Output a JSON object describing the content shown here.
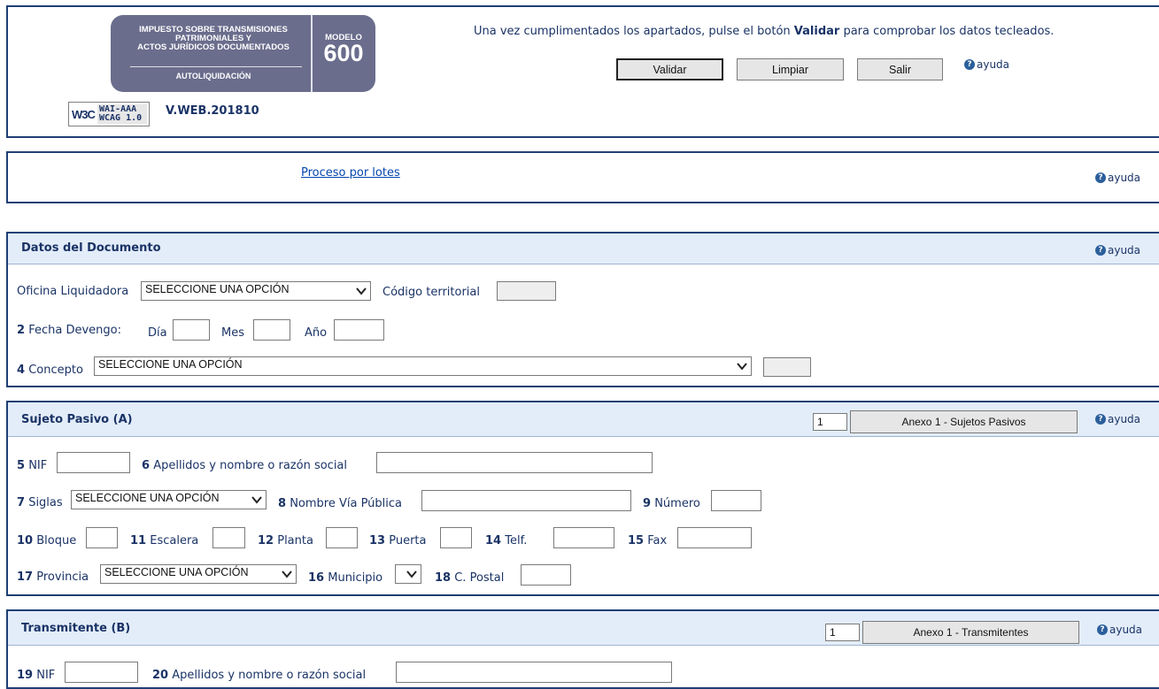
{
  "header": {
    "logo": {
      "line1": "IMPUESTO SOBRE TRANSMISIONES",
      "line2": "PATRIMONIALES Y",
      "line3": "ACTOS JURÍDICOS DOCUMENTADOS",
      "line4": "AUTOLIQUIDACIÓN",
      "modelo_label": "MODELO",
      "modelo_num": "600"
    },
    "w3c": {
      "logo": "W3C",
      "badge_line1": "WAI-AAA",
      "badge_line2": "WCAG 1.0"
    },
    "version": "V.WEB.201810",
    "instructions_pre": "Una vez cumplimentados los apartados, pulse el botón ",
    "instructions_bold": "Validar",
    "instructions_post": " para comprobar los datos tecleados.",
    "buttons": {
      "validar": "Validar",
      "limpiar": "Limpiar",
      "salir": "Salir"
    },
    "help": "ayuda"
  },
  "lotes": {
    "link": "Proceso por lotes",
    "help": "ayuda"
  },
  "documento": {
    "title": "Datos del Documento",
    "help": "ayuda",
    "oficina_label": "Oficina Liquidadora",
    "oficina_value": "SELECCIONE UNA OPCIÓN",
    "codigo_label": "Código territorial",
    "fecha_num": "2",
    "fecha_label": "Fecha Devengo:",
    "dia_label": "Día",
    "mes_label": "Mes",
    "anio_label": "Año",
    "concepto_num": "4",
    "concepto_label": "Concepto",
    "concepto_value": "SELECCIONE UNA OPCIÓN"
  },
  "sujeto": {
    "title": "Sujeto Pasivo (A)",
    "help": "ayuda",
    "count": "1",
    "anexo_button": "Anexo 1 - Sujetos Pasivos",
    "f5_num": "5",
    "f5_label": "NIF",
    "f6_num": "6",
    "f6_label": "Apellidos y nombre o razón social",
    "f7_num": "7",
    "f7_label": "Siglas",
    "f7_value": "SELECCIONE UNA OPCIÓN",
    "f8_num": "8",
    "f8_label": "Nombre Vía Pública",
    "f9_num": "9",
    "f9_label": "Número",
    "f10_num": "10",
    "f10_label": "Bloque",
    "f11_num": "11",
    "f11_label": "Escalera",
    "f12_num": "12",
    "f12_label": "Planta",
    "f13_num": "13",
    "f13_label": "Puerta",
    "f14_num": "14",
    "f14_label": "Telf.",
    "f15_num": "15",
    "f15_label": "Fax",
    "f17_num": "17",
    "f17_label": "Provincia",
    "f17_value": "SELECCIONE UNA OPCIÓN",
    "f16_num": "16",
    "f16_label": "Municipio",
    "f18_num": "18",
    "f18_label": "C. Postal"
  },
  "transmitente": {
    "title": "Transmitente (B)",
    "help": "ayuda",
    "count": "1",
    "anexo_button": "Anexo 1 - Transmitentes",
    "f19_num": "19",
    "f19_label": "NIF",
    "f20_num": "20",
    "f20_label": "Apellidos y nombre o razón social"
  }
}
